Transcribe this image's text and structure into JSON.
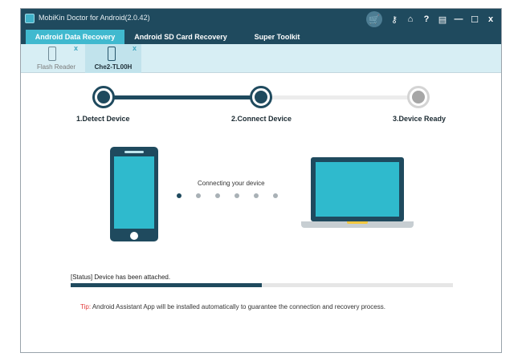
{
  "app": {
    "title": "MobiKin Doctor for Android(2.0.42)"
  },
  "titlebar_icons": [
    {
      "name": "cart-icon",
      "glyph": "🛒"
    },
    {
      "name": "key-icon",
      "glyph": "⚷"
    },
    {
      "name": "home-icon",
      "glyph": "⌂"
    },
    {
      "name": "help-icon",
      "glyph": "?"
    },
    {
      "name": "register-icon",
      "glyph": "▤"
    },
    {
      "name": "minimize-icon",
      "glyph": "—"
    },
    {
      "name": "maximize-icon",
      "glyph": "☐"
    },
    {
      "name": "close-icon",
      "glyph": "x"
    }
  ],
  "main_tabs": [
    {
      "label": "Android Data Recovery",
      "active": true
    },
    {
      "label": "Android SD Card Recovery",
      "active": false
    },
    {
      "label": "Super Toolkit",
      "active": false
    }
  ],
  "device_tabs": [
    {
      "label": "Flash Reader",
      "close": "x",
      "active": false
    },
    {
      "label": "Che2-TL00H",
      "close": "x",
      "active": true
    }
  ],
  "steps": [
    {
      "label": "1.Detect Device",
      "state": "done"
    },
    {
      "label": "2.Connect Device",
      "state": "done"
    },
    {
      "label": "3.Device Ready",
      "state": "todo"
    }
  ],
  "connection": {
    "message": "Connecting your device",
    "dot_count": 6,
    "active_dot": 0
  },
  "status": {
    "text": "[Status] Device has been attached.",
    "progress": 0.5
  },
  "tip": {
    "prefix": "Tip:",
    "text": "Android Assistant App will be installed automatically to guarantee the connection and recovery process."
  },
  "colors": {
    "primary_dark": "#1f4a5e",
    "accent": "#40b9cf",
    "device_bar": "#d7eef4",
    "tip_red": "#e23c3c"
  }
}
